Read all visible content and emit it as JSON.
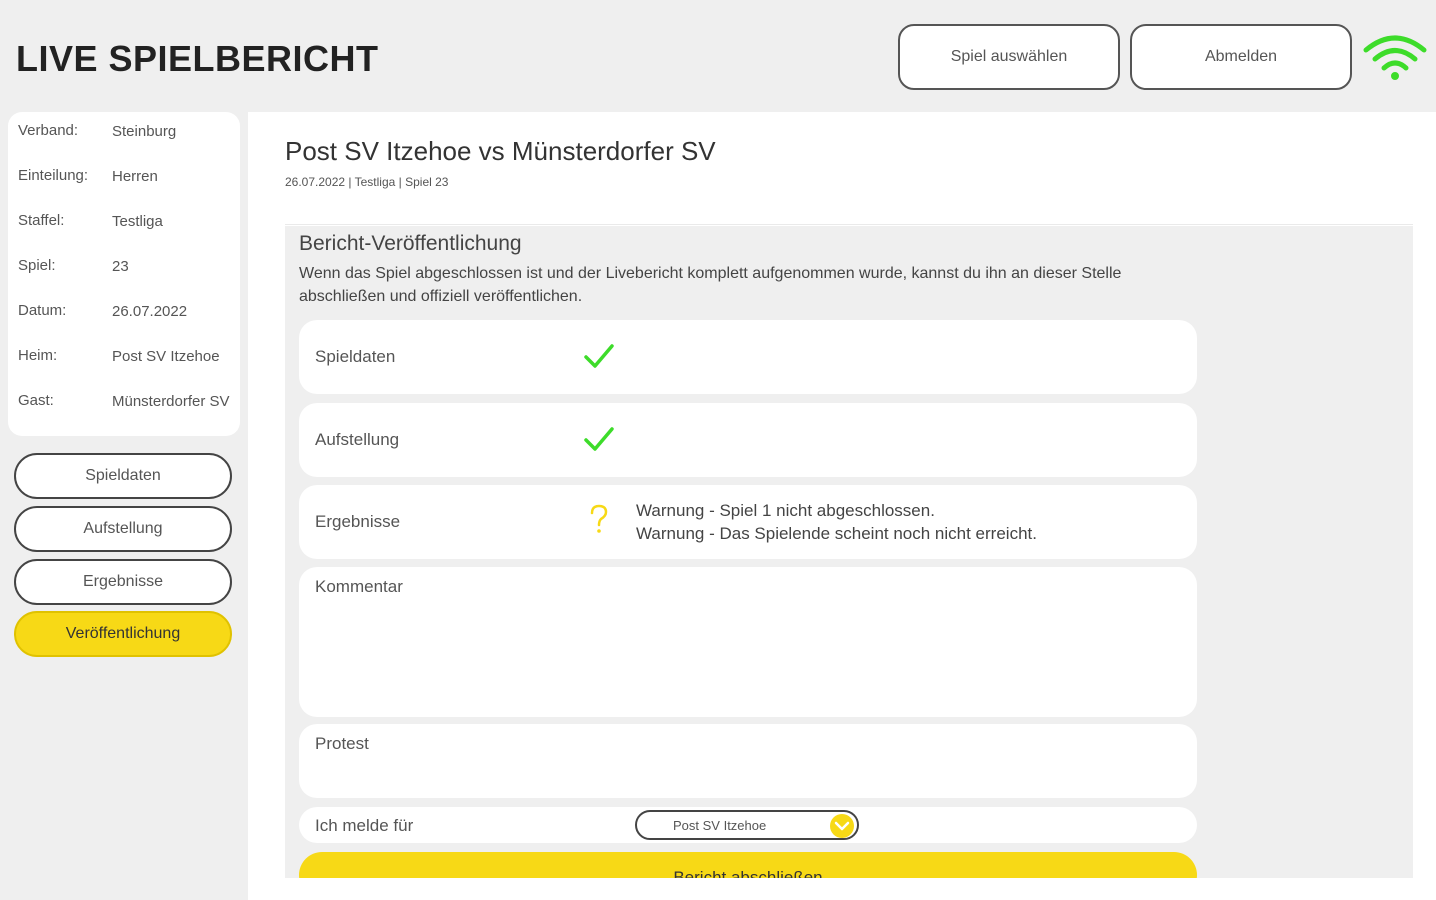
{
  "app": {
    "title": "LIVE SPIELBERICHT"
  },
  "header": {
    "select_game_label": "Spiel auswählen",
    "logout_label": "Abmelden",
    "connection_icon": "wifi-icon",
    "connection_color": "#3ddc2a"
  },
  "sidebar": {
    "info": [
      {
        "label": "Verband:",
        "value": "Steinburg"
      },
      {
        "label": "Einteilung:",
        "value": "Herren"
      },
      {
        "label": "Staffel:",
        "value": "Testliga"
      },
      {
        "label": "Spiel:",
        "value": "23"
      },
      {
        "label": "Datum:",
        "value": "26.07.2022"
      },
      {
        "label": "Heim:",
        "value": "Post SV Itzehoe"
      },
      {
        "label": "Gast:",
        "value": "Münsterdorfer SV"
      }
    ],
    "nav": [
      {
        "label": "Spieldaten",
        "active": false
      },
      {
        "label": "Aufstellung",
        "active": false
      },
      {
        "label": "Ergebnisse",
        "active": false
      },
      {
        "label": "Veröffentlichung",
        "active": true
      }
    ]
  },
  "main": {
    "match_title": "Post SV Itzehoe vs Münsterdorfer SV",
    "match_meta": "26.07.2022 | Testliga | Spiel 23",
    "panel": {
      "title": "Bericht-Veröffentlichung",
      "description": "Wenn das Spiel abgeschlossen ist und der Livebericht komplett aufgenommen wurde, kannst du ihn an dieser Stelle abschließen und offiziell veröffentlichen.",
      "checks": [
        {
          "label": "Spieldaten",
          "status": "ok",
          "icon": "check-icon"
        },
        {
          "label": "Aufstellung",
          "status": "ok",
          "icon": "check-icon"
        },
        {
          "label": "Ergebnisse",
          "status": "warning",
          "icon": "question-icon",
          "warnings": [
            "Warnung - Spiel 1 nicht abgeschlossen.",
            "Warnung - Das Spielende scheint noch nicht erreicht."
          ]
        }
      ],
      "comment_label": "Kommentar",
      "protest_label": "Protest",
      "report_for_label": "Ich melde für",
      "report_for_value": "Post SV Itzehoe",
      "submit_label": "Bericht abschließen"
    }
  },
  "colors": {
    "accent": "#f7d916",
    "ok": "#3ddc2a",
    "warning": "#f7d916"
  }
}
